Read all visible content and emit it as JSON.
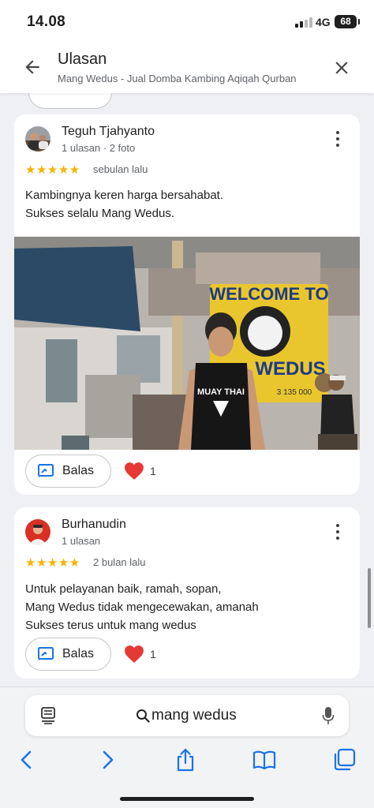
{
  "status": {
    "time": "14.08",
    "network": "4G",
    "battery": "68"
  },
  "header": {
    "title": "Ulasan",
    "subtitle": "Mang Wedus - Jual Domba Kambing Aqiqah Qurban"
  },
  "reviews": [
    {
      "name": "Teguh Tjahyanto",
      "meta": "1 ulasan · 2 foto",
      "stars": "★★★★★",
      "rating": 5,
      "date": "sebulan lalu",
      "text_lines": [
        "Kambingnya keren harga bersahabat.",
        "Sukses selalu Mang Wedus."
      ],
      "photo": {
        "banner_text": "WELCOME TO",
        "banner_text2": "WEDUS",
        "shirt_text": "MUAY THAI",
        "banner_phone": "3 135 000"
      },
      "reply_label": "Balas",
      "likes": "1"
    },
    {
      "name": "Burhanudin",
      "meta": "1 ulasan",
      "stars": "★★★★★",
      "rating": 5,
      "date": "2 bulan lalu",
      "text_lines": [
        "Untuk pelayanan baik, ramah, sopan,",
        "Mang Wedus tidak mengecewakan, amanah",
        "Sukses terus untuk mang wedus"
      ],
      "reply_label": "Balas",
      "likes": "1"
    }
  ],
  "browser": {
    "url": "mang wedus"
  },
  "colors": {
    "star": "#f4b400",
    "accent": "#1a73e8",
    "heart": "#e53935",
    "card_bg": "#ffffff",
    "page_bg": "#eef0f3"
  }
}
